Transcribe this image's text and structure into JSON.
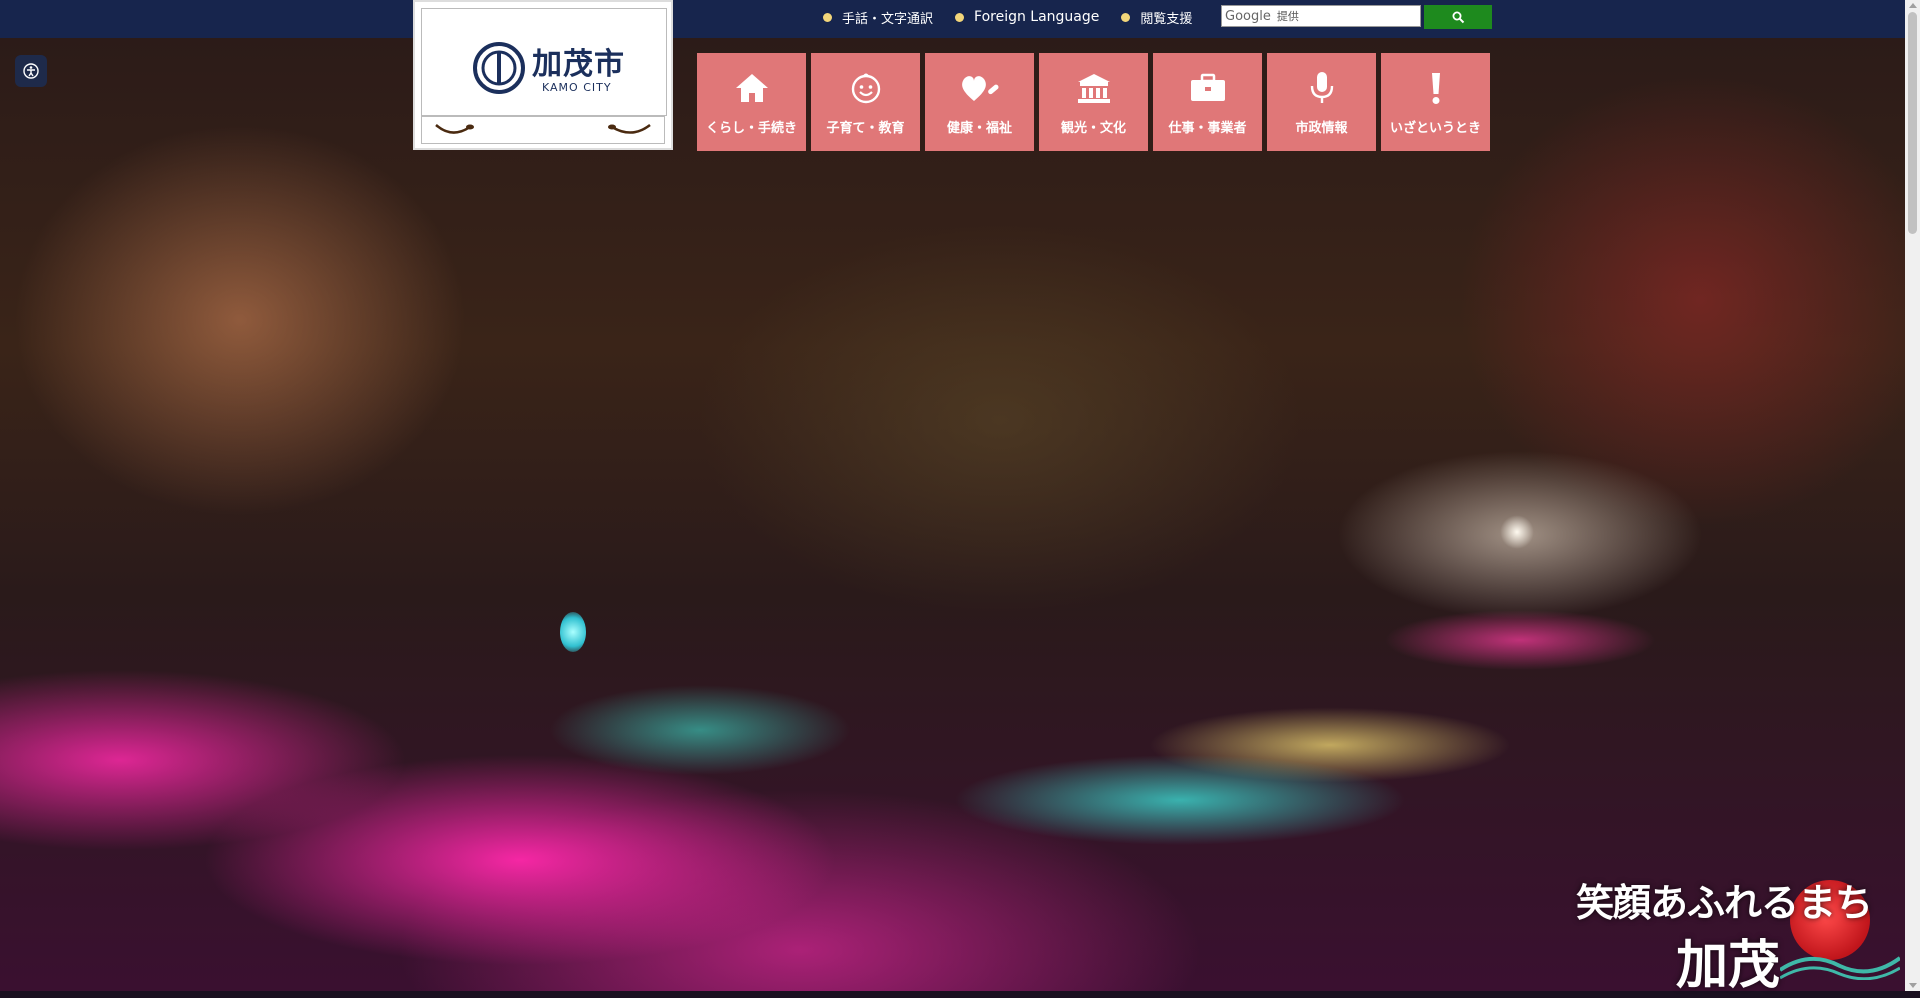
{
  "header": {
    "links": [
      {
        "label": "手話・文字通訳"
      },
      {
        "label": "Foreign Language"
      },
      {
        "label": "閲覧支援"
      }
    ],
    "search": {
      "brand": "Google",
      "placeholder": "提供",
      "button_icon": "search-icon"
    }
  },
  "logo": {
    "title": "加茂市",
    "subtitle": "KAMO CITY",
    "emblem_icon": "city-emblem-icon"
  },
  "nav": [
    {
      "label": "くらし・手続き",
      "icon": "house-icon"
    },
    {
      "label": "子育て・教育",
      "icon": "smiley-face-icon"
    },
    {
      "label": "健康・福祉",
      "icon": "heart-icon"
    },
    {
      "label": "観光・文化",
      "icon": "temple-icon"
    },
    {
      "label": "仕事・事業者",
      "icon": "briefcase-icon"
    },
    {
      "label": "市政情報",
      "icon": "microphone-icon"
    },
    {
      "label": "いざというとき",
      "icon": "exclamation-icon"
    }
  ],
  "slogan": {
    "line1": "笑顔あふれるまち",
    "line2": "加茂"
  },
  "accessibility_button": {
    "icon": "accessibility-icon"
  },
  "colors": {
    "topbar": "#17254d",
    "nav_tile": "#e07778",
    "search_button": "#1e8a1e",
    "logo_text": "#1b2f5c"
  }
}
